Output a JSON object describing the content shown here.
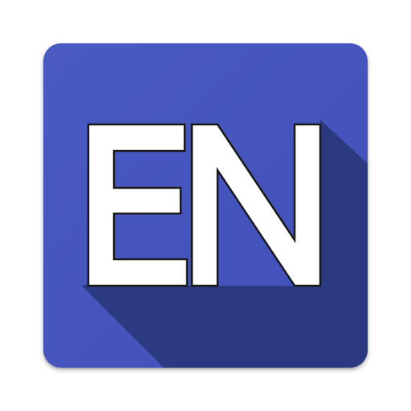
{
  "app_icon": {
    "label": "EN",
    "colors": {
      "background": "#4150b8",
      "background_highlight": "#4a5ac3",
      "long_shadow": "#2b3a80",
      "letter_fill": "#ffffff",
      "letter_outline": "#1a1a1a"
    }
  }
}
